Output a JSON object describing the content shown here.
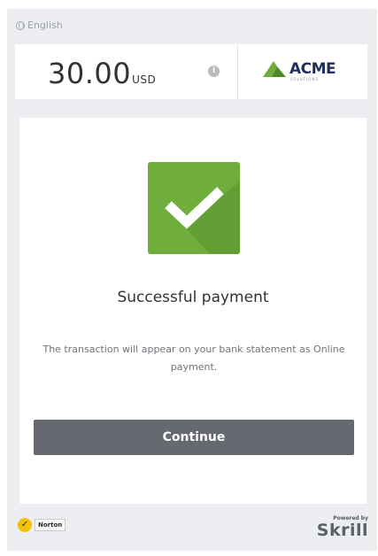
{
  "header": {
    "language": "English",
    "language_icon": "globe-icon"
  },
  "amount": {
    "value": "30.00",
    "currency": "USD",
    "info_icon": "info-icon"
  },
  "merchant": {
    "name": "ACME",
    "tagline": "SOLUTIONS",
    "brand_color": "#1f2e5a",
    "accent_color": "#6fae3d"
  },
  "result": {
    "status_icon": "checkmark-icon",
    "status_color": "#6fae3d",
    "title": "Successful payment",
    "message": "The transaction will appear on your bank statement as Online payment."
  },
  "actions": {
    "continue_label": "Continue",
    "button_color": "#666a70"
  },
  "footer": {
    "norton_label": "Norton",
    "powered_by": "Powered by",
    "provider": "Skrill"
  }
}
